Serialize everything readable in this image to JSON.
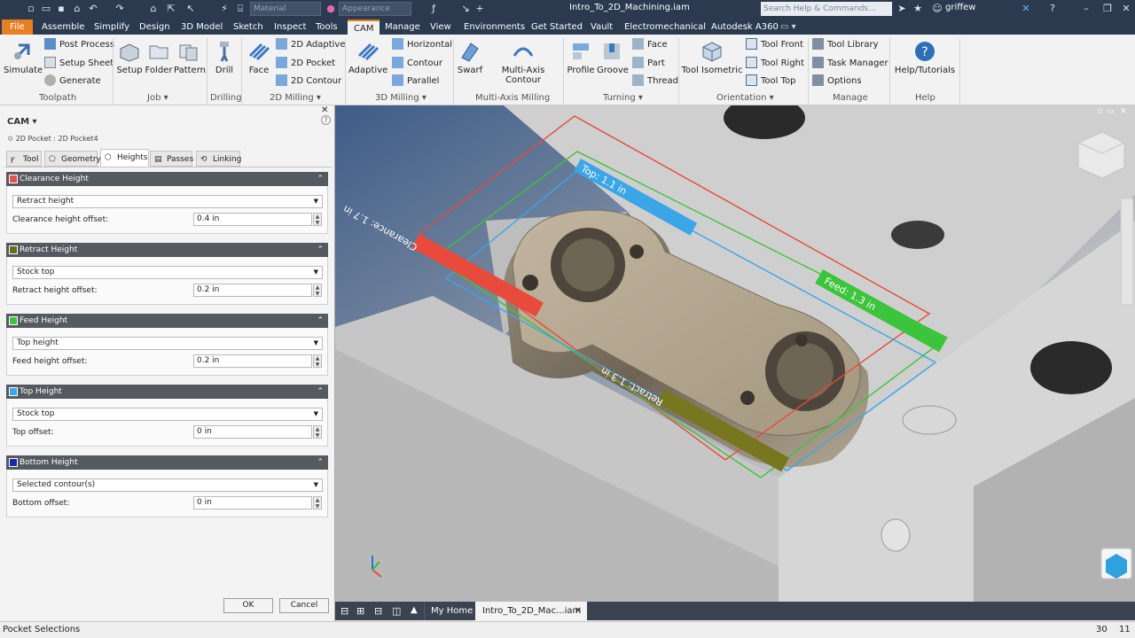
{
  "titlebar": {
    "material_dd": "Material",
    "appearance_dd": "Appearance",
    "doc_title": "Intro_To_2D_Machining.iam",
    "search_placeholder": "Search Help & Commands...",
    "user": "griffew"
  },
  "tabs": [
    "File",
    "Assemble",
    "Simplify",
    "Design",
    "3D Model",
    "Sketch",
    "Inspect",
    "Tools",
    "CAM",
    "Manage",
    "View",
    "Environments",
    "Get Started",
    "Vault",
    "Electromechanical",
    "Autodesk A360"
  ],
  "active_tab": "CAM",
  "ribbon": {
    "toolpath": {
      "simulate": "Simulate",
      "post_process": "Post Process",
      "setup_sheet": "Setup Sheet",
      "generate": "Generate",
      "group": "Toolpath"
    },
    "job": {
      "setup": "Setup",
      "folder": "Folder",
      "pattern": "Pattern",
      "group": "Job"
    },
    "drilling": {
      "drill": "Drill",
      "group": "Drilling"
    },
    "milling2d": {
      "face": "Face",
      "adaptive": "2D Adaptive",
      "pocket": "2D Pocket",
      "contour": "2D Contour",
      "group": "2D Milling"
    },
    "milling3d": {
      "adaptive": "Adaptive",
      "horizontal": "Horizontal",
      "contour": "Contour",
      "parallel": "Parallel",
      "group": "3D Milling"
    },
    "multiaxis": {
      "swarf": "Swarf",
      "multi_contour": "Multi-Axis Contour",
      "group": "Multi-Axis Milling"
    },
    "turning": {
      "profile": "Profile",
      "groove": "Groove",
      "face": "Face",
      "part": "Part",
      "thread": "Thread",
      "group": "Turning"
    },
    "orientation": {
      "isometric": "Tool Isometric",
      "front": "Tool Front",
      "right": "Tool Right",
      "top": "Tool Top",
      "group": "Orientation"
    },
    "manage": {
      "library": "Tool Library",
      "task": "Task Manager",
      "options": "Options",
      "group": "Manage"
    },
    "help": {
      "tutorials": "Help/Tutorials",
      "group": "Help"
    }
  },
  "panel": {
    "title": "CAM",
    "breadcrumb": "2D Pocket : 2D Pocket4",
    "tabs": [
      "Tool",
      "Geometry",
      "Heights",
      "Passes",
      "Linking"
    ],
    "active_tab": "Heights",
    "sections": [
      {
        "title": "Clearance Height",
        "color": "#e8504a",
        "select": "Retract height",
        "offset_label": "Clearance height offset:",
        "offset_value": "0.4 in"
      },
      {
        "title": "Retract Height",
        "color": "#6b6b20",
        "select": "Stock top",
        "offset_label": "Retract height offset:",
        "offset_value": "0.2 in"
      },
      {
        "title": "Feed Height",
        "color": "#3cc43c",
        "select": "Top height",
        "offset_label": "Feed height offset:",
        "offset_value": "0.2 in"
      },
      {
        "title": "Top Height",
        "color": "#3aa6e8",
        "select": "Stock top",
        "offset_label": "Top offset:",
        "offset_value": "0 in"
      },
      {
        "title": "Bottom Height",
        "color": "#1b2aa8",
        "select": "Selected contour(s)",
        "offset_label": "Bottom offset:",
        "offset_value": "0 in"
      }
    ],
    "ok": "OK",
    "cancel": "Cancel"
  },
  "viewport": {
    "labels": {
      "top": "Top: 1.1 in",
      "clearance": "Clearance: 1.7 in",
      "feed": "Feed: 1.3 in",
      "retract": "Retract: 1.3 in"
    }
  },
  "doctabs": {
    "home": "My Home",
    "doc": "Intro_To_2D_Mac...iam"
  },
  "status": {
    "text": "Pocket Selections",
    "n1": "30",
    "n2": "11"
  }
}
